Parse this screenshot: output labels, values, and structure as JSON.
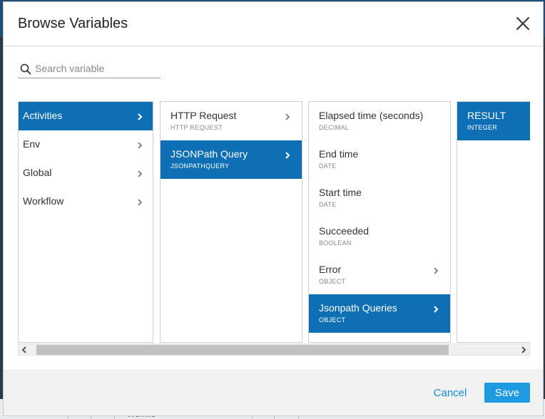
{
  "background": {
    "partial_text": "Workflo"
  },
  "dialog": {
    "title": "Browse Variables",
    "close_icon": "close-icon"
  },
  "search": {
    "placeholder": "Search variable",
    "value": "",
    "icon": "search-icon"
  },
  "columns": [
    {
      "items": [
        {
          "label": "Activities",
          "selected": true,
          "has_children": true
        },
        {
          "label": "Env",
          "selected": false,
          "has_children": true
        },
        {
          "label": "Global",
          "selected": false,
          "has_children": true
        },
        {
          "label": "Workflow",
          "selected": false,
          "has_children": true
        }
      ]
    },
    {
      "items": [
        {
          "label": "HTTP Request",
          "type": "HTTP REQUEST",
          "selected": false,
          "has_children": true
        },
        {
          "label": "JSONPath Query",
          "type": "JSONPATHQUERY",
          "selected": true,
          "has_children": true
        }
      ]
    },
    {
      "items": [
        {
          "label": "Elapsed time (seconds)",
          "type": "DECIMAL",
          "selected": false,
          "has_children": false
        },
        {
          "label": "End time",
          "type": "DATE",
          "selected": false,
          "has_children": false
        },
        {
          "label": "Start time",
          "type": "DATE",
          "selected": false,
          "has_children": false
        },
        {
          "label": "Succeeded",
          "type": "BOOLEAN",
          "selected": false,
          "has_children": false
        },
        {
          "label": "Error",
          "type": "OBJECT",
          "selected": false,
          "has_children": true
        },
        {
          "label": "Jsonpath Queries",
          "type": "OBJECT",
          "selected": true,
          "has_children": true
        }
      ]
    },
    {
      "items": [
        {
          "label": "RESULT",
          "type": "INTEGER",
          "selected": true,
          "has_children": false
        }
      ]
    }
  ],
  "footer": {
    "cancel_label": "Cancel",
    "save_label": "Save"
  },
  "colors": {
    "accent": "#0f6fb4",
    "button": "#1e9be0",
    "link": "#1a8ad4"
  }
}
